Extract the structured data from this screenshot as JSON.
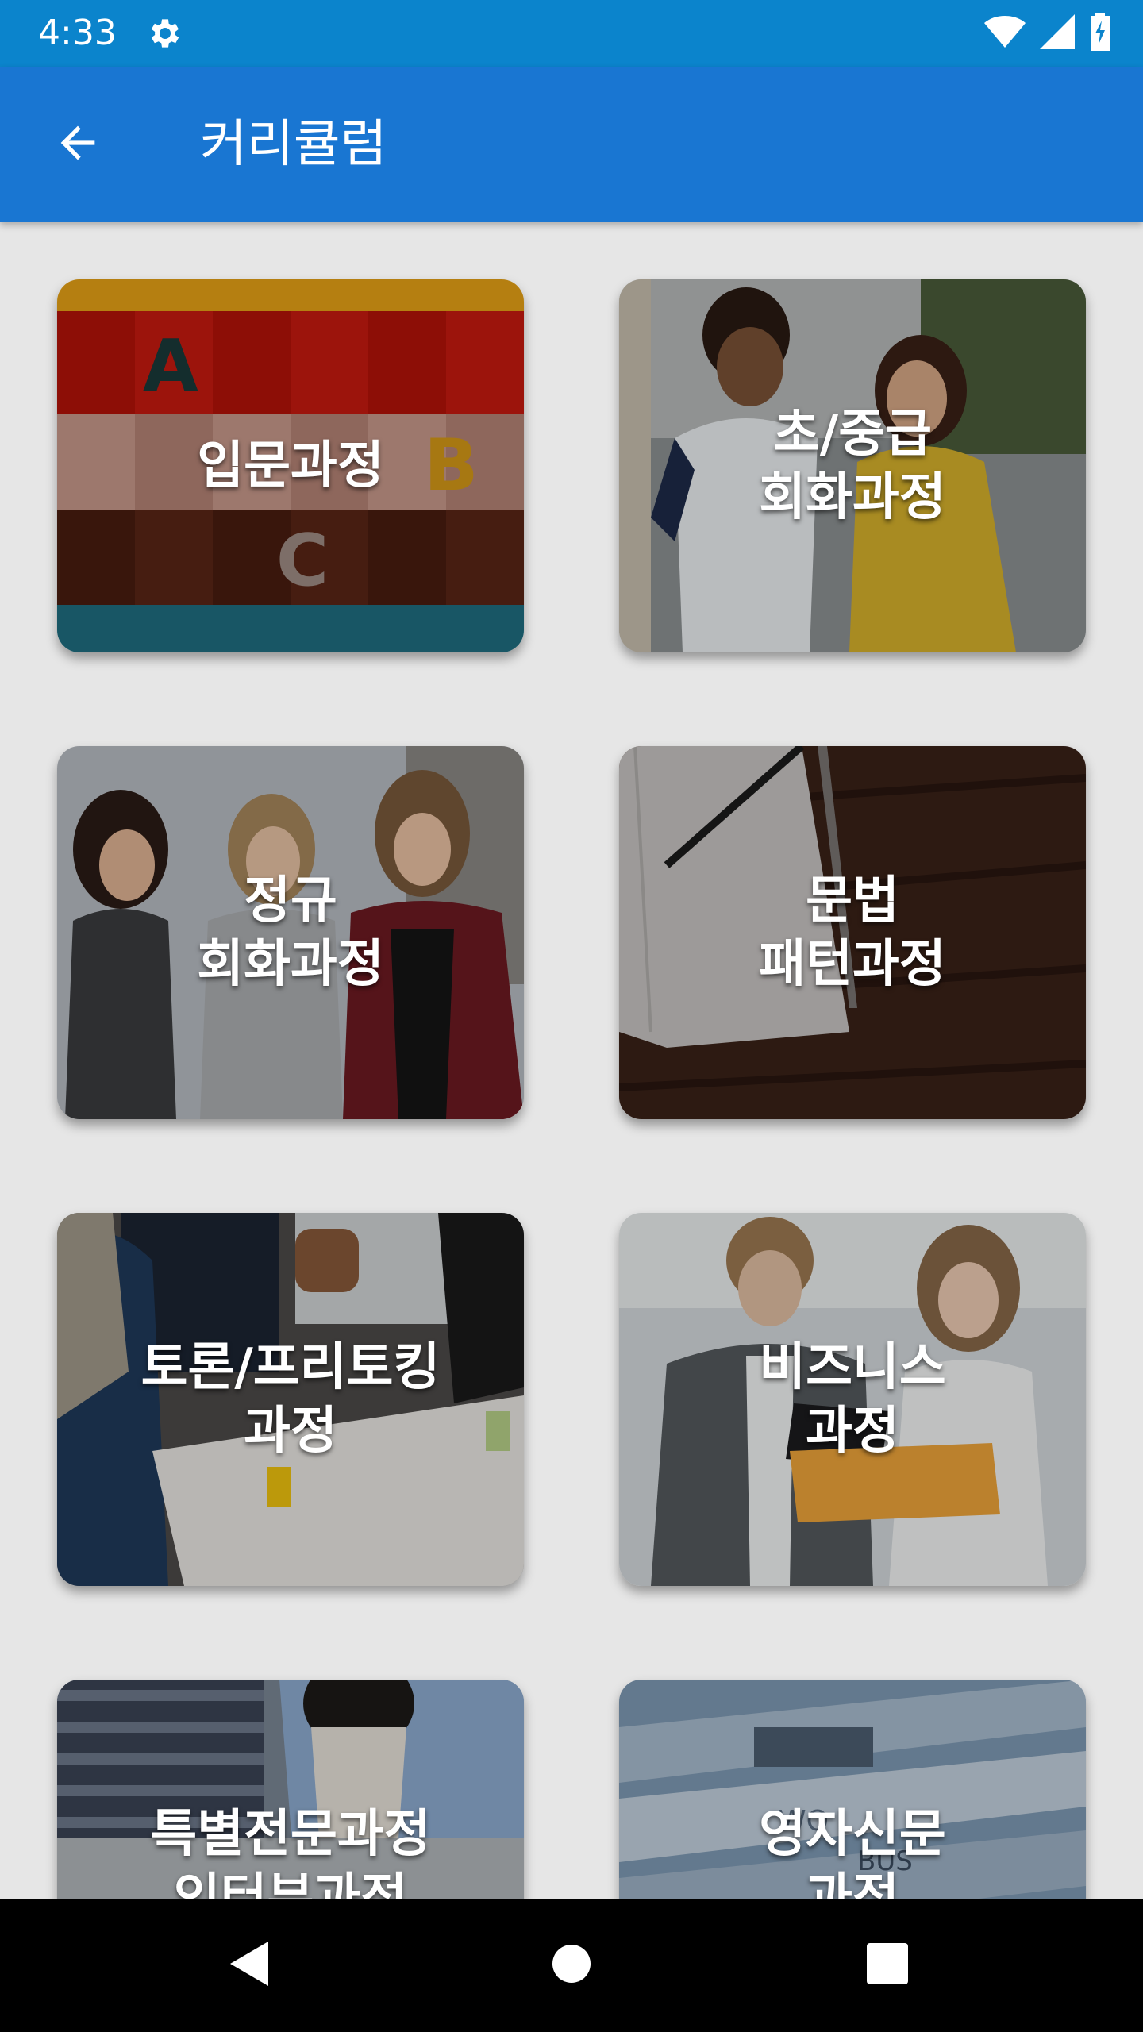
{
  "status_bar": {
    "time": "4:33",
    "icons": [
      "gear-icon",
      "wifi-icon",
      "cell-signal-icon",
      "battery-charging-icon"
    ]
  },
  "app_bar": {
    "title": "커리큘럼",
    "back_icon": "arrow-back-icon"
  },
  "colors": {
    "status_bar": "#0b84cc",
    "app_bar": "#1976d2",
    "background": "#e6e6e6",
    "nav_bar": "#000000"
  },
  "courses": [
    {
      "label": "입문과정",
      "photo": "abc-letter-blocks"
    },
    {
      "label": "초/중급\n회화과정",
      "photo": "two-students-talking"
    },
    {
      "label": "정규\n회화과정",
      "photo": "three-women-laughing"
    },
    {
      "label": "문법\n패턴과정",
      "photo": "notebook-on-wood"
    },
    {
      "label": "토론/프리토킹\n과정",
      "photo": "group-at-table"
    },
    {
      "label": "비즈니스\n과정",
      "photo": "business-people-documents"
    },
    {
      "label": "특별전문과정\n인터뷰과정",
      "photo": "students-with-laptop"
    },
    {
      "label": "영자신문\n과정",
      "photo": "newspapers"
    }
  ],
  "nav_bar": {
    "icons": [
      "back-triangle-icon",
      "home-circle-icon",
      "recents-square-icon"
    ]
  }
}
